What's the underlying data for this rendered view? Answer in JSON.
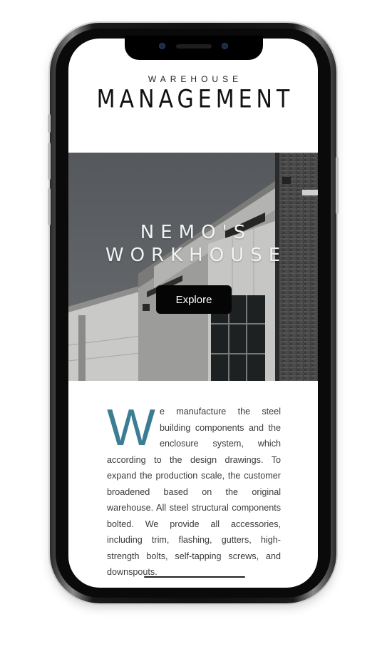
{
  "header": {
    "eyebrow": "WAREHOUSE",
    "title": "MANAGEMENT"
  },
  "hero": {
    "title_line1": "NEMO'S",
    "title_line2": "WORKHOUSE",
    "button_label": "Explore"
  },
  "content": {
    "drop_cap": "W",
    "body": "e manufacture the steel building components and the enclosure system, which according to the design drawings. To expand the production scale, the customer broadened based on the original warehouse. All steel structural components bolted. We provide all accessories, including trim, flashing, gutters, high-strength bolts, self-tapping screws, and downspouts."
  },
  "colors": {
    "accent": "#3d7d93",
    "button_bg": "#050505",
    "text": "#3a3a3a"
  },
  "icons": {
    "front_camera": "camera-icon",
    "speaker": "speaker-icon"
  }
}
